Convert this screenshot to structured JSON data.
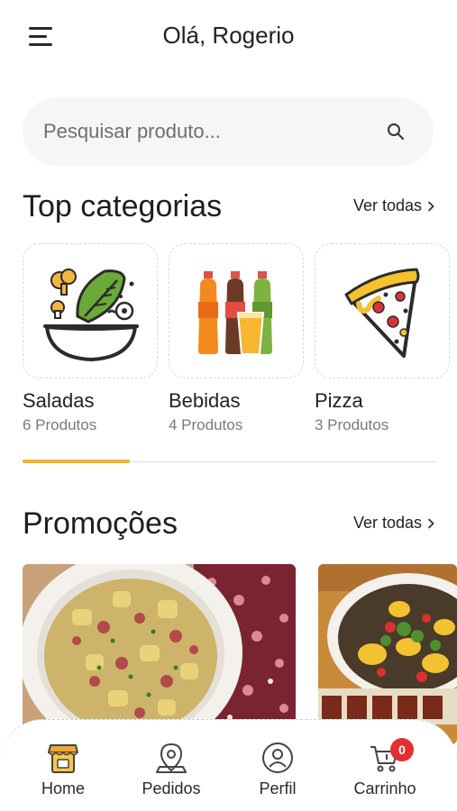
{
  "header": {
    "greeting": "Olá, Rogerio",
    "menu_icon": "menu-icon"
  },
  "search": {
    "placeholder": "Pesquisar produto...",
    "value": "",
    "icon": "search-icon"
  },
  "categories_section": {
    "title": "Top categorias",
    "see_all": "Ver todas",
    "items": [
      {
        "name": "Saladas",
        "count": "6 Produtos",
        "icon": "salad-icon"
      },
      {
        "name": "Bebidas",
        "count": "4 Produtos",
        "icon": "drinks-icon"
      },
      {
        "name": "Pizza",
        "count": "3 Produtos",
        "icon": "pizza-icon"
      }
    ],
    "scroll_progress": 0.26,
    "indicator_color": "#f0b323"
  },
  "promotions_section": {
    "title": "Promoções",
    "see_all": "Ver todas",
    "items": [
      {
        "image": "octopus-potato-salad-photo"
      },
      {
        "image": "grilled-vegetables-plate-photo"
      }
    ]
  },
  "bottom_nav": {
    "items": [
      {
        "label": "Home",
        "icon": "store-icon",
        "active": true
      },
      {
        "label": "Pedidos",
        "icon": "map-pin-icon",
        "active": false
      },
      {
        "label": "Perfil",
        "icon": "user-icon",
        "active": false
      },
      {
        "label": "Carrinho",
        "icon": "cart-icon",
        "active": false,
        "badge": "0"
      }
    ]
  },
  "colors": {
    "accent": "#f0b323",
    "badge": "#e03131",
    "search_bg": "#f6f6f6"
  }
}
